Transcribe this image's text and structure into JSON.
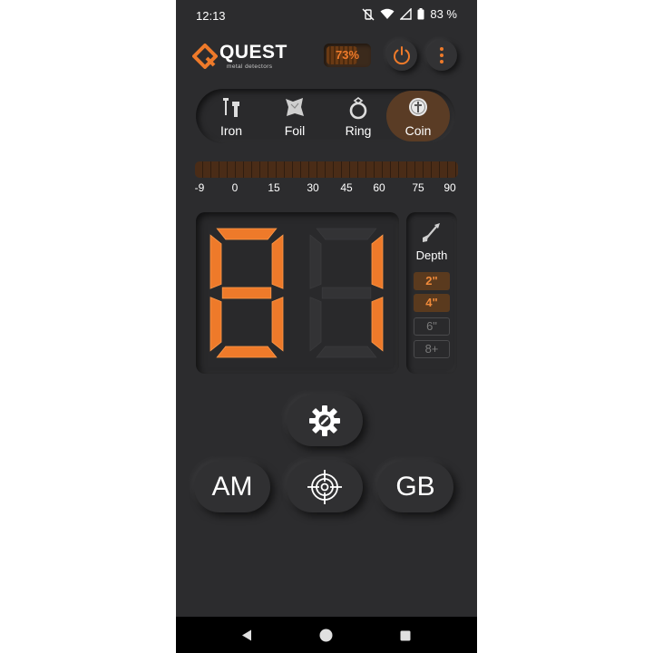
{
  "status_bar": {
    "time": "12:13",
    "battery_percent": "83 %"
  },
  "header": {
    "brand_name": "QUEST",
    "brand_tagline": "metal detectors",
    "battery_level_text": "73%",
    "battery_level_fraction": 0.73
  },
  "modes": [
    {
      "label": "Iron",
      "icon": "iron-nail-icon",
      "active": false
    },
    {
      "label": "Foil",
      "icon": "foil-icon",
      "active": false
    },
    {
      "label": "Ring",
      "icon": "ring-icon",
      "active": false
    },
    {
      "label": "Coin",
      "icon": "coin-icon",
      "active": true
    }
  ],
  "scale": {
    "ticks": [
      "-9",
      "0",
      "15",
      "30",
      "45",
      "60",
      "75",
      "90"
    ]
  },
  "display": {
    "digits": "81"
  },
  "depth": {
    "label": "Depth",
    "options": [
      {
        "label": "2\"",
        "active": true
      },
      {
        "label": "4\"",
        "active": true
      },
      {
        "label": "6\"",
        "active": false
      },
      {
        "label": "8+",
        "active": false
      }
    ]
  },
  "buttons": {
    "left_label": "AM",
    "right_label": "GB"
  },
  "colors": {
    "accent": "#ee7a2a",
    "background": "#2c2c2e",
    "active_mode": "#5a3c25"
  }
}
